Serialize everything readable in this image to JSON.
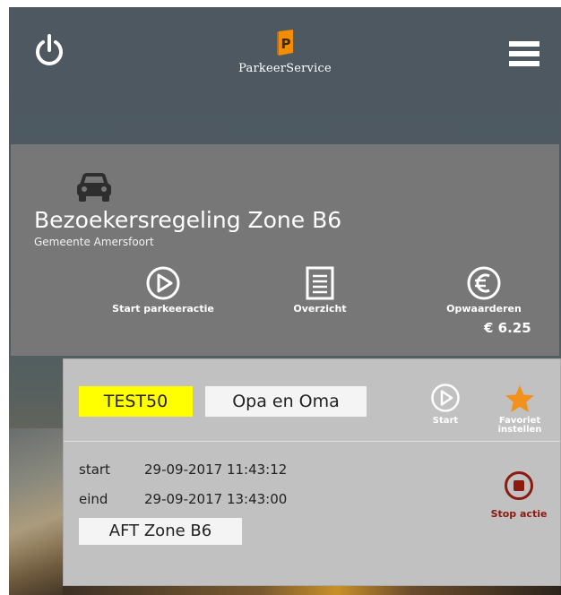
{
  "header": {
    "logo_text": "ParkeerService",
    "logo_letter": "P"
  },
  "zone": {
    "title": "Bezoekersregeling Zone B6",
    "municipality": "Gemeente Amersfoort",
    "actions": [
      {
        "label": "Start parkeeractie",
        "icon": "play-circle-icon"
      },
      {
        "label": "Overzicht",
        "icon": "document-list-icon"
      },
      {
        "label": "Opwaarderen",
        "icon": "euro-circle-icon"
      }
    ],
    "balance": "€ 6.25"
  },
  "session": {
    "plate": "TEST50",
    "name": "Opa en Oma",
    "start_btn": "Start",
    "fav_btn_line1": "Favoriet",
    "fav_btn_line2": "instellen",
    "start_label": "start",
    "start_value": "29-09-2017 11:43:12",
    "end_label": "eind",
    "end_value": "29-09-2017 13:43:00",
    "zone": "AFT Zone B6",
    "stop_btn": "Stop actie"
  },
  "colors": {
    "header_bg": "#4d5860",
    "panel_bg": "#777777",
    "card_bg": "#c1c1c1",
    "plate_bg": "#ffff00",
    "star": "#f2921d",
    "stop": "#8b1a10",
    "logo_orange": "#f28c00"
  }
}
